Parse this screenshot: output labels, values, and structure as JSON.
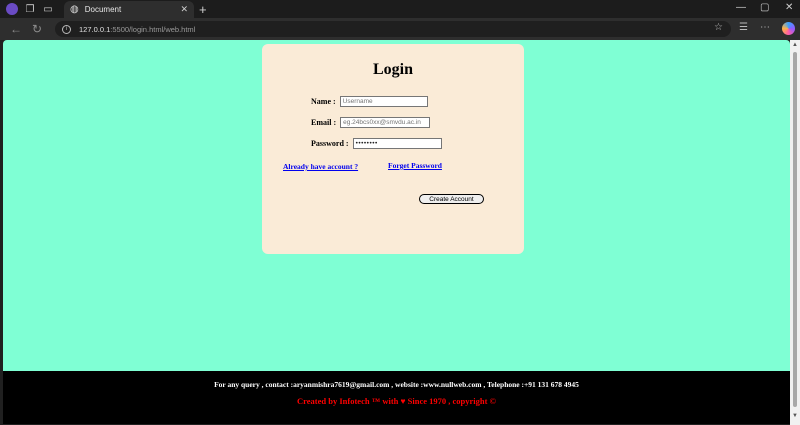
{
  "browser": {
    "tab_title": "Document",
    "url_host": "127.0.0.1",
    "url_rest": ":5500/login.html/web.html"
  },
  "login": {
    "heading": "Login",
    "name_label": "Name :",
    "name_placeholder": "Username",
    "email_label": "Email :",
    "email_placeholder": "eg.24bcs0xx@smvdu.ac.in",
    "password_label": "Password :",
    "password_value": "••••••••",
    "have_account_link": "Already have account ?",
    "forget_password_link": "Forget Password",
    "create_button": "Create Account"
  },
  "footer": {
    "contact_line": "For any query , contact :aryanmishra7619@gmail.com , website :www.nullweb.com , Telephone :+91 131 678 4945",
    "credit_line": "Created by Infotech ™  with ♥  Since 1970 , copyright ©"
  },
  "colors": {
    "page_background": "#7fffd4",
    "card_background": "#faebd7",
    "footer_background": "#000000",
    "credit_text": "#ff0000"
  }
}
